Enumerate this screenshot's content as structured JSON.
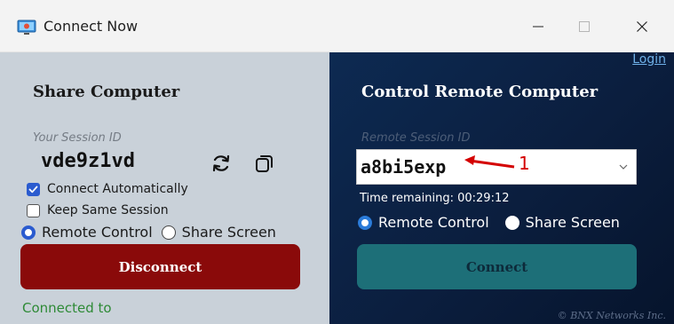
{
  "window": {
    "title": "Connect Now",
    "minimize_glyph": "—",
    "maximize_glyph": "☐",
    "close_glyph": "✕"
  },
  "share": {
    "title": "Share Computer",
    "session_label": "Your Session ID",
    "session_id": "vde9z1vd",
    "connect_automatically": {
      "label": "Connect Automatically",
      "checked": true
    },
    "keep_same_session": {
      "label": "Keep Same Session",
      "checked": false
    },
    "mode_remote_control": "Remote Control",
    "mode_share_screen": "Share Screen",
    "disconnect_label": "Disconnect",
    "status_text": "Connected to"
  },
  "control": {
    "login_label": "Login",
    "title": "Control Remote Computer",
    "remote_label": "Remote Session ID",
    "remote_id": "a8bi5exp",
    "annotation_number": "1",
    "time_remaining": "Time remaining: 00:29:12",
    "mode_remote_control": "Remote Control",
    "mode_share_screen": "Share Screen",
    "connect_label": "Connect",
    "copyright": "© BNX Networks Inc."
  },
  "colors": {
    "disconnect_bg": "#8a0a0a",
    "connect_bg": "#1d6f78",
    "status_green": "#2e8a36",
    "accent_blue": "#2a5bcf",
    "annotation_red": "#d40000"
  }
}
